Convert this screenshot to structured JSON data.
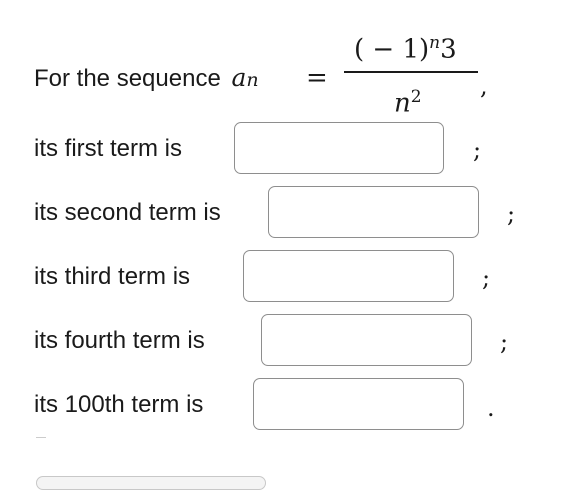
{
  "prompt": {
    "lead_text": "For the sequence",
    "sequence_symbol": "a",
    "sequence_index": "n",
    "equals": "=",
    "numerator_open": "( − 1)",
    "numerator_exponent": "n",
    "numerator_factor": "3",
    "denominator_base": "n",
    "denominator_exponent": "2",
    "trailing_comma": ","
  },
  "rows": [
    {
      "label": "its first term is",
      "value": "",
      "punct": ";"
    },
    {
      "label": "its second term is",
      "value": "",
      "punct": ";"
    },
    {
      "label": "its third term is",
      "value": "",
      "punct": ";"
    },
    {
      "label": "its fourth term is",
      "value": "",
      "punct": ";"
    },
    {
      "label": "its 100th term is",
      "value": "",
      "punct": "."
    }
  ]
}
